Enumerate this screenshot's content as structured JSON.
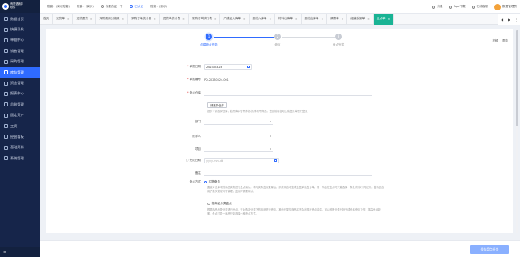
{
  "brand": {
    "line1": "有赞进销存",
    "line2": "软件"
  },
  "sidebar": {
    "items": [
      {
        "label": "数据首页",
        "icon": "home-icon"
      },
      {
        "label": "快捷导航",
        "icon": "compass-icon"
      },
      {
        "label": "单据中心",
        "icon": "document-icon"
      },
      {
        "label": "销售管理",
        "icon": "cart-icon"
      },
      {
        "label": "采购管理",
        "icon": "truck-icon"
      },
      {
        "label": "库存管理",
        "icon": "box-icon",
        "active": true
      },
      {
        "label": "资金管理",
        "icon": "wallet-icon"
      },
      {
        "label": "报表中心",
        "icon": "chart-icon"
      },
      {
        "label": "总账管理",
        "icon": "ledger-icon"
      },
      {
        "label": "固定资产",
        "icon": "building-icon"
      },
      {
        "label": "工资",
        "icon": "money-icon"
      },
      {
        "label": "经营看板",
        "icon": "dashboard-icon"
      },
      {
        "label": "基础资料",
        "icon": "database-icon"
      },
      {
        "label": "系统管理",
        "icon": "gear-icon"
      }
    ],
    "collapse_glyph": "≡"
  },
  "topbar": {
    "account": "账套：(演示账套)",
    "account2": "账套：(演示)",
    "switch": "我要办证一下",
    "verify": "已认证",
    "company": "账套：(演示)",
    "messages": "消息",
    "app_download": "App下载",
    "online_service": "在线客服",
    "user": "数据管理员"
  },
  "tabs": [
    {
      "label": "首页",
      "closable": false
    },
    {
      "label": "进货单",
      "closable": true
    },
    {
      "label": "进货退货",
      "closable": true
    },
    {
      "label": "采购费用分摊表",
      "closable": true
    },
    {
      "label": "采购订单统计表",
      "closable": true
    },
    {
      "label": "进货单统计表",
      "closable": true
    },
    {
      "label": "采购订单执行表",
      "closable": true
    },
    {
      "label": "产成品入库单",
      "closable": true
    },
    {
      "label": "其他入库单",
      "closable": true
    },
    {
      "label": "材料出库单",
      "closable": true
    },
    {
      "label": "其他出库单",
      "closable": true
    },
    {
      "label": "调拨单",
      "closable": true
    },
    {
      "label": "组装拆卸单",
      "closable": true
    },
    {
      "label": "盘点单",
      "closable": true,
      "active": true
    }
  ],
  "tab_controls": {
    "prev": "◀",
    "next": "▶",
    "more": "⋮"
  },
  "steps": [
    {
      "num": "1",
      "label": "创建盘点任务",
      "active": true
    },
    {
      "num": "2",
      "label": "盘点",
      "active": false
    },
    {
      "num": "3",
      "label": "盘点完成",
      "active": false
    }
  ],
  "card_tools": {
    "help": "帮助",
    "video": "视频"
  },
  "form": {
    "date": {
      "label": "单据日期",
      "value": "2023-03-24"
    },
    "number": {
      "label": "单据编号",
      "value": "PD-20230324-001"
    },
    "warehouse": {
      "label": "盘点仓库",
      "button": "请选择仓库",
      "hint": "提示：请选择仓库，若仓库中含有多批次/序列号商品，盘点前将自动生成盘点单进行盘点"
    },
    "department": {
      "label": "部门",
      "placeholder": ""
    },
    "handler": {
      "label": "经手人",
      "placeholder": ""
    },
    "project": {
      "label": "项目",
      "placeholder": ""
    },
    "deadline": {
      "label": "完成日期",
      "placeholder": "yyyy-mm-dd"
    },
    "remark": {
      "label": "备注",
      "value": ""
    },
    "method": {
      "label": "盘点方式",
      "option1": "实物盘点",
      "option1_desc": "直接对仓库中的商品实物进行盘点确认，填写实际盘点数量后，系统将自动生成盘盈单或盘亏单。同一商品在盘点时只能选择一条批次/序列号记录，若商品启用了批次或序列号管理，盘点时需要确认。",
      "option2": "按商品分类盘点",
      "option2_desc": "根据商品所属分类进行盘点，只对选定分类下的商品进行盘点，其他分类的商品将不会出现在盘点单中，可以按照分类分批完成仓库盘点工作，提高盘点效率。盘点时同一商品只能选择一种盘点方式。"
    }
  },
  "footer": {
    "save": "保存盘点任务"
  }
}
